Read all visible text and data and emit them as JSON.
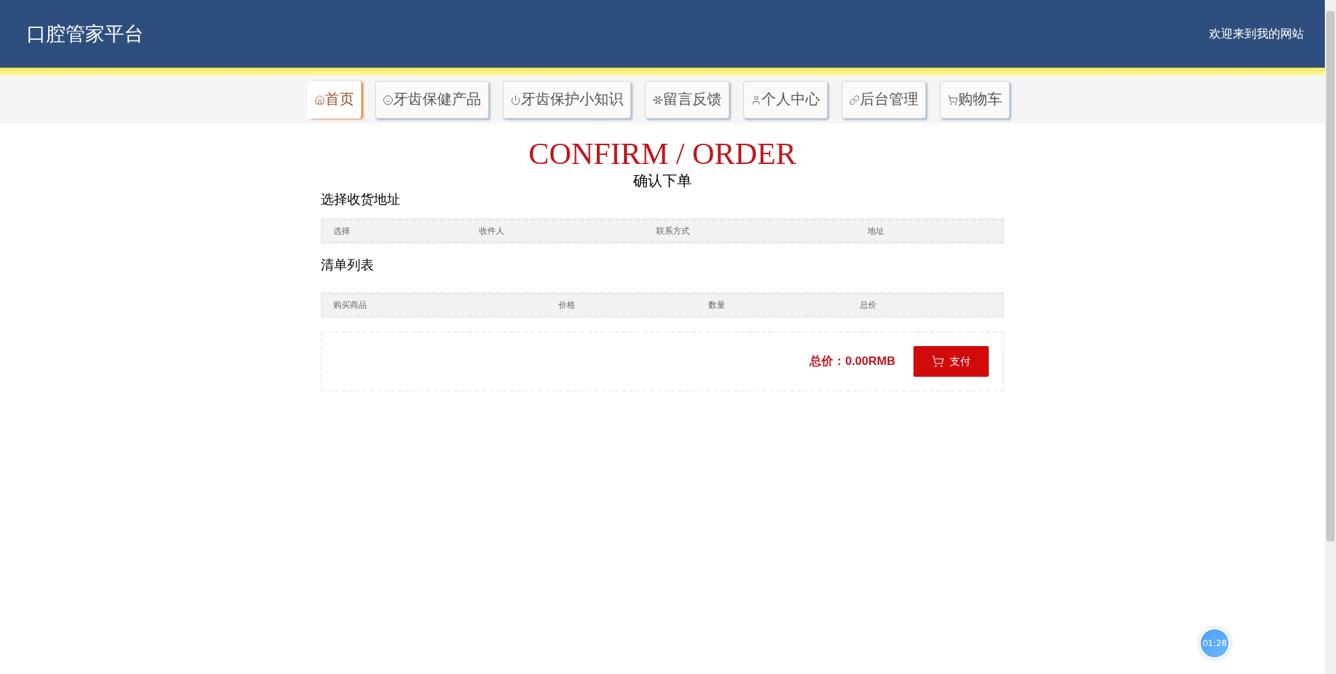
{
  "header": {
    "title": "口腔管家平台",
    "welcome": "欢迎来到我的网站"
  },
  "nav": [
    {
      "kind": "home",
      "label": "首页",
      "selected": true
    },
    {
      "kind": "tooth",
      "label": "牙齿保健产品",
      "selected": false
    },
    {
      "kind": "power",
      "label": "牙齿保护小知识",
      "selected": false
    },
    {
      "kind": "snow",
      "label": "留言反馈",
      "selected": false
    },
    {
      "kind": "user",
      "label": "个人中心",
      "selected": false
    },
    {
      "kind": "link",
      "label": "后台管理",
      "selected": false
    },
    {
      "kind": "cart",
      "label": "购物车",
      "selected": false
    }
  ],
  "heading": {
    "english": "CONFIRM / ORDER",
    "chinese": "确认下单"
  },
  "address_section": {
    "title": "选择收货地址",
    "columns": [
      "选择",
      "收件人",
      "联系方式",
      "地址"
    ]
  },
  "list_section": {
    "title": "清单列表",
    "columns": [
      "购买商品",
      "价格",
      "数量",
      "总价"
    ]
  },
  "summary": {
    "total": "总价：0.00RMB",
    "pay_button": "支付"
  },
  "timer": "01:28"
}
